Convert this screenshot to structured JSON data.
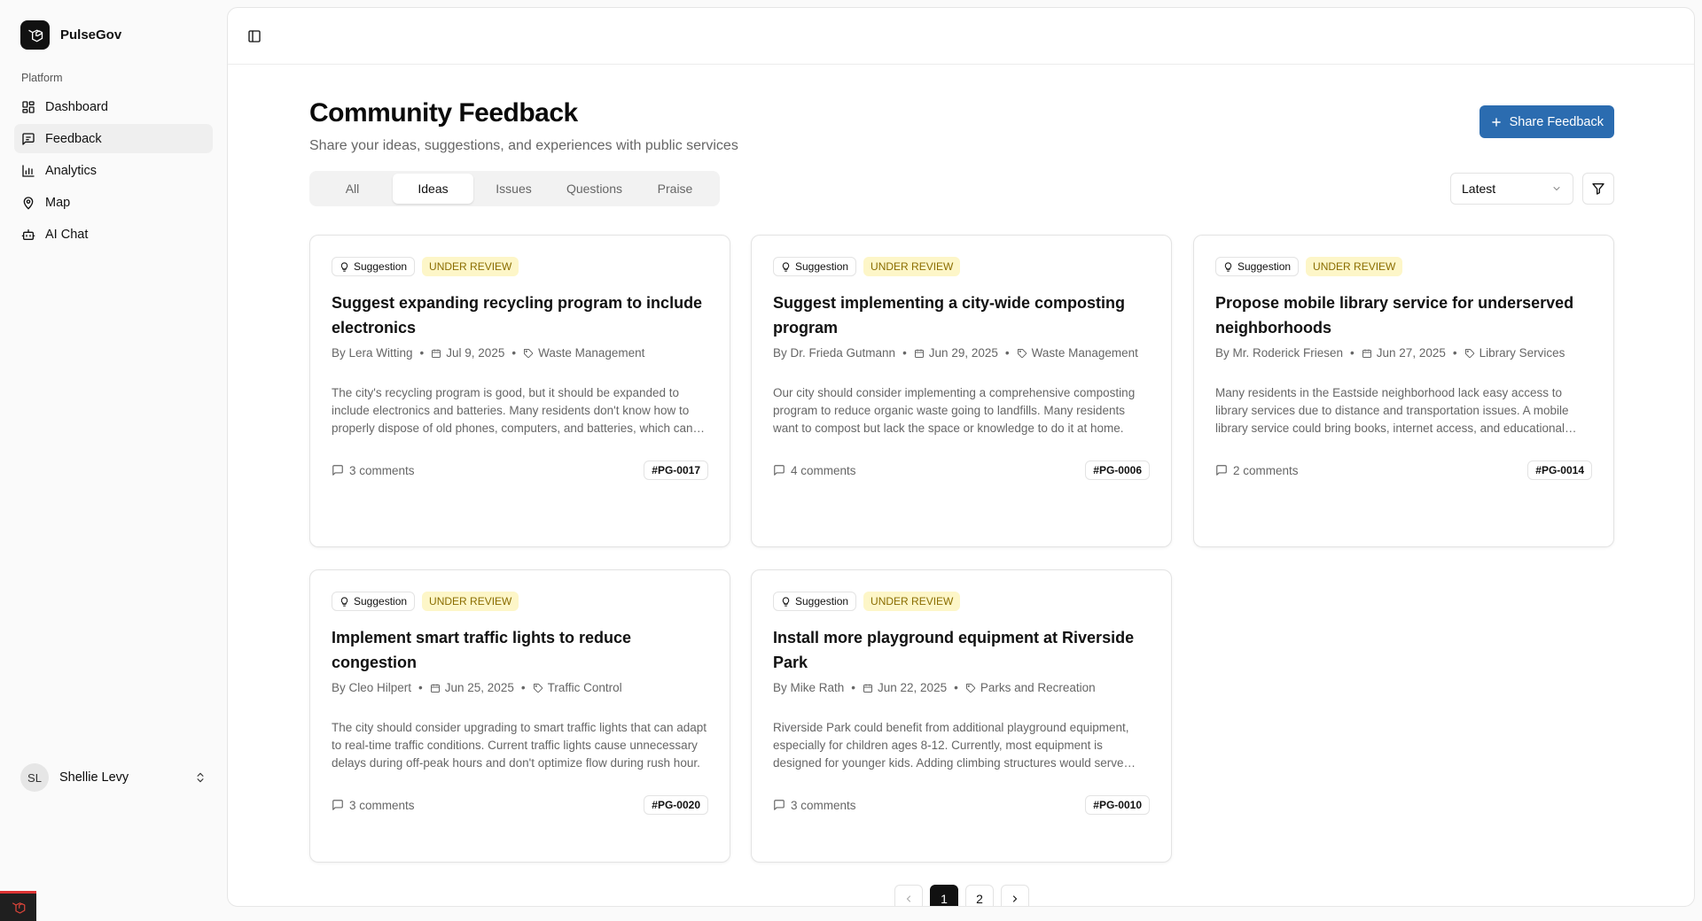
{
  "app": {
    "name": "PulseGov"
  },
  "sidebar": {
    "group_label": "Platform",
    "items": [
      {
        "label": "Dashboard",
        "icon": "dashboard-icon",
        "active": false
      },
      {
        "label": "Feedback",
        "icon": "message-square-icon",
        "active": true
      },
      {
        "label": "Analytics",
        "icon": "bar-chart-icon",
        "active": false
      },
      {
        "label": "Map",
        "icon": "map-pin-icon",
        "active": false
      },
      {
        "label": "AI Chat",
        "icon": "bot-icon",
        "active": false
      }
    ],
    "user": {
      "initials": "SL",
      "name": "Shellie Levy"
    }
  },
  "page": {
    "title": "Community Feedback",
    "subtitle": "Share your ideas, suggestions, and experiences with public services",
    "primary_button": "Share Feedback"
  },
  "tabs": [
    {
      "label": "All",
      "active": false
    },
    {
      "label": "Ideas",
      "active": true
    },
    {
      "label": "Issues",
      "active": false
    },
    {
      "label": "Questions",
      "active": false
    },
    {
      "label": "Praise",
      "active": false
    }
  ],
  "sort": {
    "value": "Latest"
  },
  "cards": [
    {
      "category": "Suggestion",
      "status": "UNDER REVIEW",
      "title": "Suggest expanding recycling program to include electronics",
      "author": "By Lera Witting",
      "date": "Jul 9, 2025",
      "tag": "Waste Management",
      "excerpt": "The city's recycling program is good, but it should be expanded to include electronics and batteries. Many residents don't know how to properly dispose of old phones, computers, and batteries, which can be harmful to the environment.",
      "comments": "3 comments",
      "id": "#PG-0017"
    },
    {
      "category": "Suggestion",
      "status": "UNDER REVIEW",
      "title": "Suggest implementing a city-wide composting program",
      "author": "By Dr. Frieda Gutmann",
      "date": "Jun 29, 2025",
      "tag": "Waste Management",
      "excerpt": "Our city should consider implementing a comprehensive composting program to reduce organic waste going to landfills. Many residents want to compost but lack the space or knowledge to do it at home.",
      "comments": "4 comments",
      "id": "#PG-0006"
    },
    {
      "category": "Suggestion",
      "status": "UNDER REVIEW",
      "title": "Propose mobile library service for underserved neighborhoods",
      "author": "By Mr. Roderick Friesen",
      "date": "Jun 27, 2025",
      "tag": "Library Services",
      "excerpt": "Many residents in the Eastside neighborhood lack easy access to library services due to distance and transportation issues. A mobile library service could bring books, internet access, and educational programs directly to them.",
      "comments": "2 comments",
      "id": "#PG-0014"
    },
    {
      "category": "Suggestion",
      "status": "UNDER REVIEW",
      "title": "Implement smart traffic lights to reduce congestion",
      "author": "By Cleo Hilpert",
      "date": "Jun 25, 2025",
      "tag": "Traffic Control",
      "excerpt": "The city should consider upgrading to smart traffic lights that can adapt to real-time traffic conditions. Current traffic lights cause unnecessary delays during off-peak hours and don't optimize flow during rush hour.",
      "comments": "3 comments",
      "id": "#PG-0020"
    },
    {
      "category": "Suggestion",
      "status": "UNDER REVIEW",
      "title": "Install more playground equipment at Riverside Park",
      "author": "By Mike Rath",
      "date": "Jun 22, 2025",
      "tag": "Parks and Recreation",
      "excerpt": "Riverside Park could benefit from additional playground equipment, especially for children ages 8-12. Currently, most equipment is designed for younger kids. Adding climbing structures would serve older children.",
      "comments": "3 comments",
      "id": "#PG-0010"
    }
  ],
  "pagination": {
    "pages": [
      "1",
      "2"
    ],
    "current": "1"
  }
}
